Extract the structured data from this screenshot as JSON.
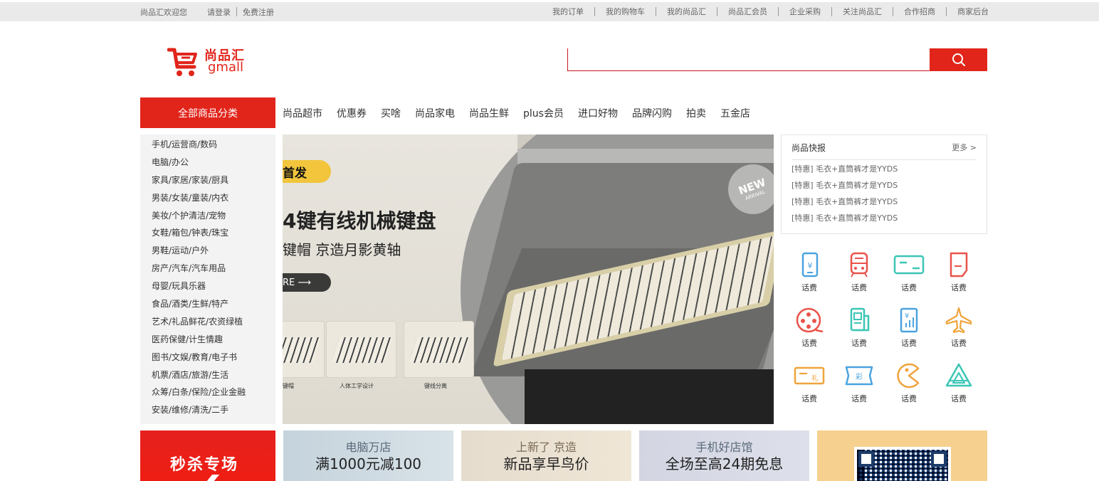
{
  "topbar": {
    "welcome": "尚品汇欢迎您",
    "login": "请登录",
    "register": "免费注册",
    "links": [
      "我的订单",
      "我的购物车",
      "我的尚品汇",
      "尚品汇会员",
      "企业采购",
      "关注尚品汇",
      "合作招商",
      "商家后台"
    ]
  },
  "logo": {
    "cn": "尚品汇",
    "en": "gmall"
  },
  "search": {
    "value": "",
    "placeholder": ""
  },
  "nav": {
    "all_categories": "全部商品分类",
    "items": [
      "尚品超市",
      "优惠券",
      "买啥",
      "尚品家电",
      "尚品生鲜",
      "plus会员",
      "进口好物",
      "品牌闪购",
      "拍卖",
      "五金店"
    ]
  },
  "categories": [
    "手机/运营商/数码",
    "电脑/办公",
    "家具/家居/家装/厨具",
    "男装/女装/童装/内衣",
    "美妆/个护清洁/宠物",
    "女鞋/箱包/钟表/珠宝",
    "男鞋/运动/户外",
    "房产/汽车/汽车用品",
    "母婴/玩具乐器",
    "食品/酒类/生鲜/特产",
    "艺术/礼品鲜花/农资绿植",
    "医药保健/计生情趣",
    "图书/文娱/教育/电子书",
    "机票/酒店/旅游/生活",
    "众筹/白条/保险/企业金融",
    "安装/维修/清洗/二手"
  ],
  "banner": {
    "badge": "首发",
    "headline": "4键有线机械键盘",
    "subline": "键帽  京造月影黄轴",
    "more": "RE ⟶",
    "new_label": "NEW",
    "new_sub": "ARRIVAL",
    "thumbs": [
      "键帽",
      "人体工学设计",
      "键线分离"
    ]
  },
  "news": {
    "title": "尚品快报",
    "more": "更多 >",
    "items": [
      "[特惠] 毛衣+直筒裤才是YYDS",
      "[特惠] 毛衣+直筒裤才是YYDS",
      "[特惠] 毛衣+直筒裤才是YYDS",
      "[特惠] 毛衣+直筒裤才是YYDS"
    ]
  },
  "services": [
    {
      "label": "话费",
      "icon": "phone-bill-icon",
      "color": "#4aa3df"
    },
    {
      "label": "话费",
      "icon": "train-icon",
      "color": "#e8534a"
    },
    {
      "label": "话费",
      "icon": "card-icon",
      "color": "#3cc6b6"
    },
    {
      "label": "话费",
      "icon": "note-icon",
      "color": "#e8534a"
    },
    {
      "label": "话费",
      "icon": "film-icon",
      "color": "#e8534a"
    },
    {
      "label": "话费",
      "icon": "ticket-icon",
      "color": "#3cc6b6"
    },
    {
      "label": "话费",
      "icon": "finance-icon",
      "color": "#4aa3df"
    },
    {
      "label": "话费",
      "icon": "plane-icon",
      "color": "#f0a33a"
    },
    {
      "label": "话费",
      "icon": "gift-card-icon",
      "color": "#f0a33a"
    },
    {
      "label": "话费",
      "icon": "lottery-icon",
      "color": "#4aa3df"
    },
    {
      "label": "话费",
      "icon": "game-icon",
      "color": "#f0a33a"
    },
    {
      "label": "话费",
      "icon": "recycle-icon",
      "color": "#3cc6b6"
    }
  ],
  "promos": [
    {
      "title": "秒杀专场"
    },
    {
      "sub": "电脑万店",
      "main": "满1000元减100"
    },
    {
      "sub": "上新了 京造",
      "main": "新品享早鸟价"
    },
    {
      "sub": "手机好店馆",
      "main": "全场至高24期免息"
    }
  ],
  "colors": {
    "brand": "#e1251b"
  }
}
